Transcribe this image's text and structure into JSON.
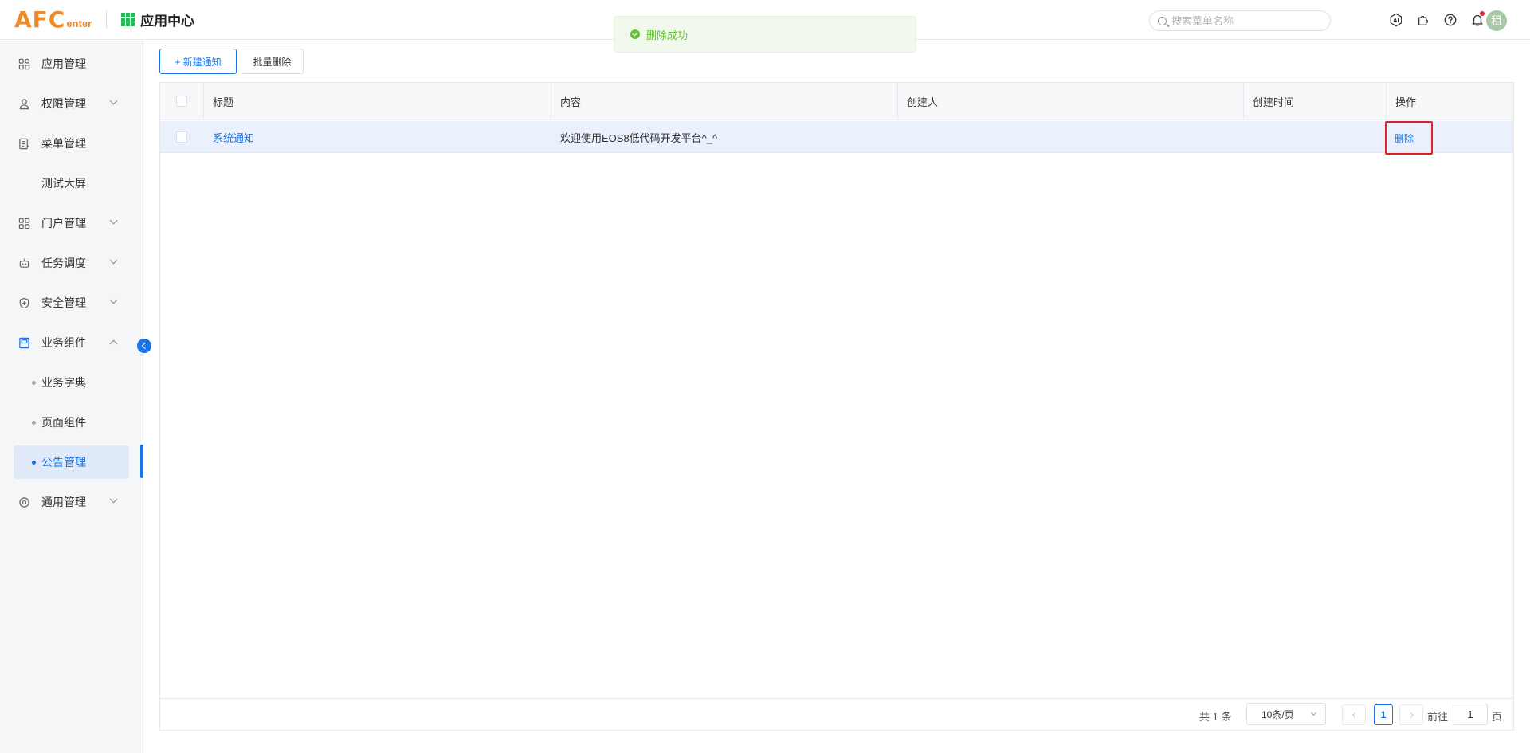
{
  "header": {
    "logo_big": "AFC",
    "logo_small": "enter",
    "app_title": "应用中心",
    "search_placeholder": "搜索菜单名称",
    "avatar_text": "租"
  },
  "toast": {
    "message": "删除成功",
    "type": "success"
  },
  "sidebar": {
    "items": [
      {
        "label": "应用管理",
        "icon": "apps-grid-icon",
        "expandable": false
      },
      {
        "label": "权限管理",
        "icon": "user-lock-icon",
        "expandable": true
      },
      {
        "label": "菜单管理",
        "icon": "menu-doc-icon",
        "expandable": false
      },
      {
        "label": "测试大屏",
        "icon": "",
        "expandable": false
      },
      {
        "label": "门户管理",
        "icon": "portal-grid-icon",
        "expandable": true
      },
      {
        "label": "任务调度",
        "icon": "robot-icon",
        "expandable": true
      },
      {
        "label": "安全管理",
        "icon": "shield-icon",
        "expandable": true
      },
      {
        "label": "业务组件",
        "icon": "component-icon",
        "expandable": true,
        "expanded": true
      },
      {
        "label": "通用管理",
        "icon": "target-icon",
        "expandable": true
      }
    ],
    "sub_items": [
      {
        "label": "业务字典"
      },
      {
        "label": "页面组件"
      },
      {
        "label": "公告管理",
        "active": true
      }
    ]
  },
  "toolbar": {
    "new_label": "+ 新建通知",
    "batch_delete_label": "批量删除"
  },
  "table": {
    "columns": [
      "标题",
      "内容",
      "创建人",
      "创建时间",
      "操作"
    ],
    "rows": [
      {
        "title": "系统通知",
        "content": "欢迎使用EOS8低代码开发平台^_^",
        "creator": "",
        "created_at": "",
        "action": "删除"
      }
    ]
  },
  "pagination": {
    "total_text": "共 1 条",
    "page_size": "10条/页",
    "current_page": "1",
    "goto_label": "前往",
    "goto_value": "1",
    "page_suffix": "页"
  },
  "colors": {
    "accent": "#1a73e8",
    "logo": "#f08a24",
    "success": "#67c23a",
    "highlight_box": "#e02020"
  }
}
